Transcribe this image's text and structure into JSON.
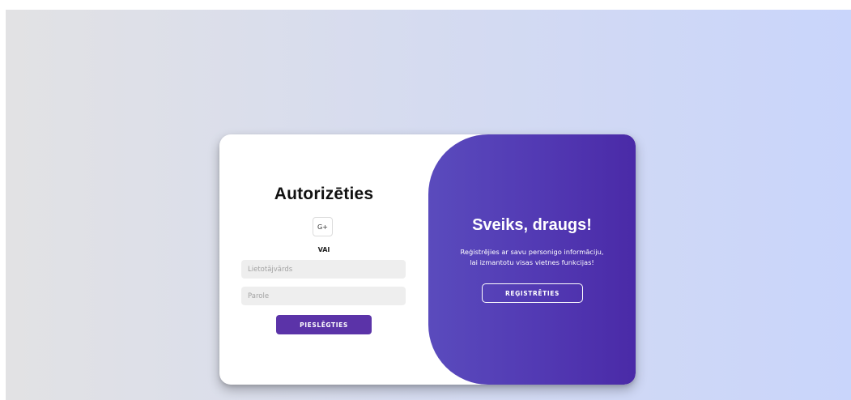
{
  "login": {
    "title": "Autorizēties",
    "social_label": "G+",
    "or_label": "VAI",
    "username_placeholder": "Lietotājvārds",
    "username_value": "",
    "password_placeholder": "Parole",
    "password_value": "",
    "submit_label": "PIESLĒGTIES"
  },
  "welcome": {
    "title": "Sveiks, draugs!",
    "line1": "Reģistrējies ar savu personigo informāciju,",
    "line2": "lai izmantotu visas vietnes funkcijas!",
    "register_label": "REĢISTRĒTIES"
  },
  "colors": {
    "accent": "#5b33a8",
    "panel_start": "#5a4bbd",
    "panel_end": "#4a2aa7"
  }
}
